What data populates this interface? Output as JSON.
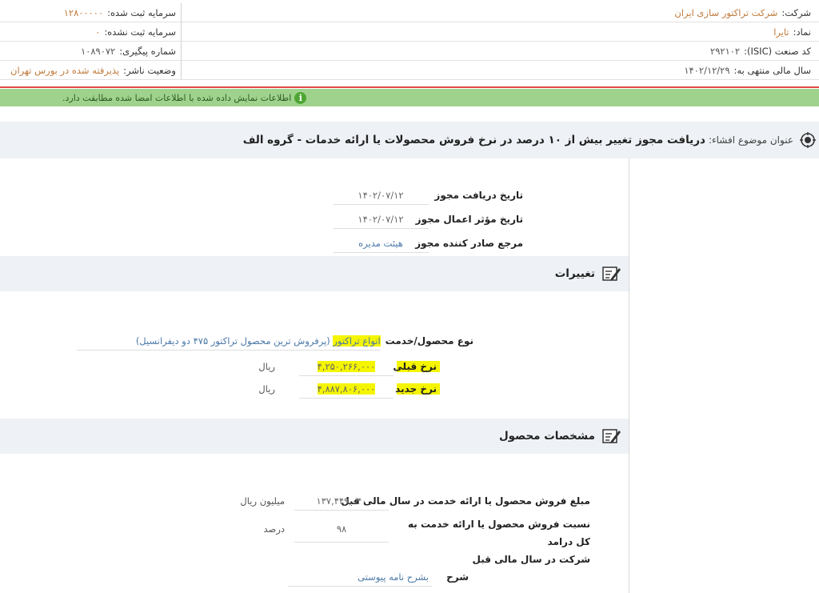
{
  "company_info": {
    "company_label": "شرکت:",
    "company_value": "شرکت تراکتور سازی ایران",
    "symbol_label": "نماد:",
    "symbol_value": "تایرا",
    "isic_label": "کد صنعت (ISIC):",
    "isic_value": "۲۹۲۱۰۲",
    "fiscal_label": "سال مالی منتهی به:",
    "fiscal_value": "۱۴۰۲/۱۲/۲۹",
    "reg_capital_label": "سرمایه ثبت شده:",
    "reg_capital_value": "۱۲۸۰۰۰۰۰",
    "unreg_capital_label": "سرمایه ثبت نشده:",
    "unreg_capital_value": "۰",
    "tracking_label": "شماره پیگیری:",
    "tracking_value": "۱۰۸۹۰۷۲",
    "publisher_label": "وضعیت ناشر:",
    "publisher_value": "پذیرفته شده در بورس تهران"
  },
  "alert": {
    "icon": "info-icon",
    "icon_glyph": "i",
    "text": "اطلاعات نمایش داده شده با اطلاعات امضا شده مطابقت دارد."
  },
  "subject": {
    "label": "عنوان موضوع افشاء:",
    "title": "دریافت مجوز تغییر بیش از ۱۰ درصد در نرخ فروش محصولات یا ارائه خدمات - گروه الف"
  },
  "permit": {
    "receive_date_label": "تاریخ دریافت مجوز",
    "receive_date_value": "۱۴۰۲/۰۷/۱۲",
    "effective_date_label": "تاریخ مؤثر اعمال مجوز",
    "effective_date_value": "۱۴۰۲/۰۷/۱۲",
    "issuer_label": "مرجع صادر کننده مجوز",
    "issuer_value": "هیئت مدیره"
  },
  "changes": {
    "section_title": "تغییرات",
    "product_type_label": "نوع محصول/خدمت",
    "product_type_value_highlight": "انواع تراکتور",
    "product_type_value_rest": " (پرفروش ترین محصول تراکتور ۴۷۵ دو دیفرانسیل)",
    "prev_rate_label": "نرخ قبلی",
    "prev_rate_value": "۴,۲۵۰,۲۶۶,۰۰۰",
    "prev_rate_unit": "ریال",
    "new_rate_label": "نرخ جدید",
    "new_rate_value": "۴,۸۸۷,۸۰۶,۰۰۰",
    "new_rate_unit": "ریال"
  },
  "product_specs": {
    "section_title": "مشخصات محصول",
    "sales_amount_label": "مبلغ فروش محصول یا ارائه خدمت در سال مالی قبل",
    "sales_amount_value": "۱۳۷,۴۴۹,۰۴۰",
    "sales_amount_unit": "میلیون ریال",
    "share_label_line1": "نسبت فروش محصول یا ارائه خدمت به کل درامد",
    "share_label_line2": "شرکت در سال مالی قبل",
    "share_value": "۹۸",
    "share_unit": "درصد",
    "desc_label": "شرح",
    "desc_value": "بشرح نامه پیوستی"
  },
  "colors": {
    "alert_bg": "#9fd38d",
    "red_line": "#e24848",
    "highlight": "#f5f500",
    "link_blue": "#4a78a8",
    "value_orange": "#c07a3a"
  }
}
